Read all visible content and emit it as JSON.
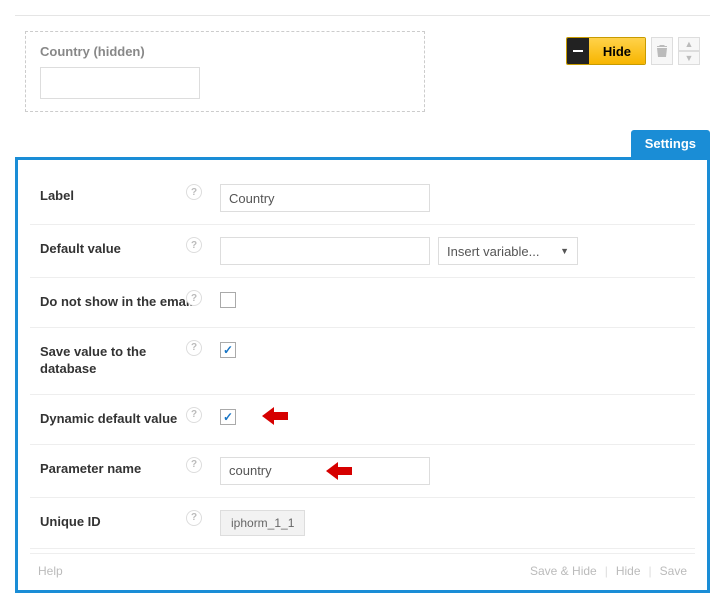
{
  "preview": {
    "label": "Country (hidden)"
  },
  "toolbar": {
    "hide_label": "Hide"
  },
  "tab": {
    "settings": "Settings"
  },
  "rows": {
    "label": {
      "title": "Label",
      "value": "Country"
    },
    "default_value": {
      "title": "Default value",
      "value": "",
      "variable_select": "Insert variable..."
    },
    "no_email": {
      "title": "Do not show in the email",
      "checked": false
    },
    "save_db": {
      "title": "Save value to the database",
      "checked": true
    },
    "dynamic": {
      "title": "Dynamic default value",
      "checked": true
    },
    "param_name": {
      "title": "Parameter name",
      "value": "country"
    },
    "uid": {
      "title": "Unique ID",
      "value": "iphorm_1_1"
    }
  },
  "footer": {
    "help": "Help",
    "save_hide": "Save & Hide",
    "hide": "Hide",
    "save": "Save"
  }
}
